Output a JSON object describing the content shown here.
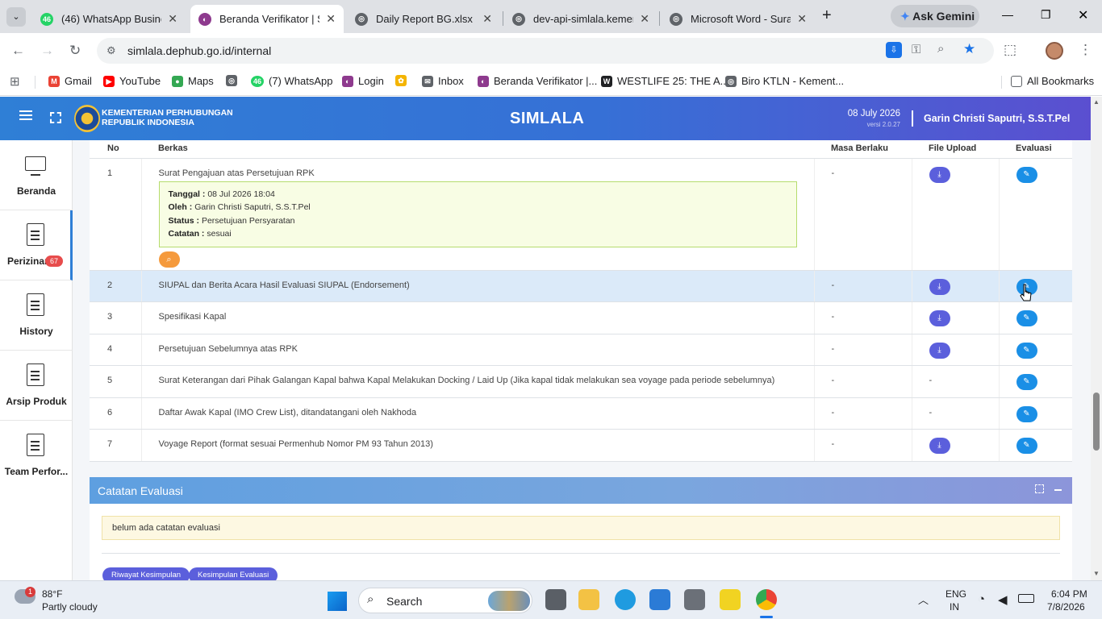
{
  "browser": {
    "tabs": [
      {
        "title": "(46) WhatsApp Busine",
        "badge": "46"
      },
      {
        "title": "Beranda Verifikator | Si"
      },
      {
        "title": "Daily Report BG.xlsx"
      },
      {
        "title": "dev-api-simlala.kemenl"
      },
      {
        "title": "Microsoft Word - Surat"
      }
    ],
    "new_tab": "+",
    "ask_gemini": "Ask Gemini",
    "url": "simlala.dephub.go.id/internal",
    "bookmarks": [
      {
        "label": "Gmail",
        "color": "#ea4335",
        "glyph": "M"
      },
      {
        "label": "YouTube",
        "color": "#ff0000",
        "glyph": "▶"
      },
      {
        "label": "Maps",
        "color": "#34a853",
        "glyph": "●"
      },
      {
        "label": "",
        "color": "#5f6368",
        "glyph": "◎"
      },
      {
        "label": "(7) WhatsApp",
        "color": "#25d366",
        "glyph": "46"
      },
      {
        "label": "Login",
        "color": "#8e3a8e",
        "glyph": "◐"
      },
      {
        "label": "",
        "color": "#f4b400",
        "glyph": "✿"
      },
      {
        "label": "Inbox",
        "color": "#5f6368",
        "glyph": "✉"
      },
      {
        "label": "Beranda Verifikator |...",
        "color": "#8e3a8e",
        "glyph": "◐"
      },
      {
        "label": "WESTLIFE 25: THE A...",
        "color": "#202124",
        "glyph": "W"
      },
      {
        "label": "Biro KTLN - Kement...",
        "color": "#5f6368",
        "glyph": "◎"
      }
    ],
    "all_bookmarks": "All Bookmarks"
  },
  "app": {
    "org_line1": "KEMENTERIAN PERHUBUNGAN",
    "org_line2": "REPUBLIK INDONESIA",
    "title": "SIMLALA",
    "date": "08 July 2026",
    "version": "versi 2.0.27",
    "user": "Garin Christi Saputri, S.S.T.Pel"
  },
  "sidebar": [
    {
      "label": "Beranda",
      "icon": "monitor-icon"
    },
    {
      "label": "Perizinan",
      "icon": "document-icon",
      "badge": "67"
    },
    {
      "label": "History",
      "icon": "document-icon"
    },
    {
      "label": "Arsip Produk",
      "icon": "document-icon"
    },
    {
      "label": "Team Perfor...",
      "icon": "document-icon"
    }
  ],
  "table": {
    "headers": [
      "No",
      "Berkas",
      "Masa Berlaku",
      "File Upload",
      "Evaluasi"
    ],
    "rows": [
      {
        "no": "1",
        "berkas": "Surat Pengajuan atas Persetujuan RPK",
        "masa": "-",
        "upload": true,
        "detail": {
          "tanggal_label": "Tanggal :",
          "tanggal": "08 Jul 2026 18:04",
          "oleh_label": "Oleh :",
          "oleh": "Garin Christi Saputri, S.S.T.Pel",
          "status_label": "Status :",
          "status": "Persetujuan Persyaratan",
          "catatan_label": "Catatan :",
          "catatan": "sesuai"
        }
      },
      {
        "no": "2",
        "berkas": "SIUPAL dan Berita Acara Hasil Evaluasi SIUPAL (Endorsement)",
        "masa": "-",
        "upload": true,
        "highlight": true
      },
      {
        "no": "3",
        "berkas": "Spesifikasi Kapal",
        "masa": "-",
        "upload": true
      },
      {
        "no": "4",
        "berkas": "Persetujuan Sebelumnya atas RPK",
        "masa": "-",
        "upload": true
      },
      {
        "no": "5",
        "berkas": "Surat Keterangan dari Pihak Galangan Kapal bahwa Kapal Melakukan Docking / Laid Up (Jika kapal tidak melakukan sea voyage pada periode sebelumnya)",
        "masa": "-",
        "upload": false,
        "upload_text": "-"
      },
      {
        "no": "6",
        "berkas": "Daftar Awak Kapal (IMO Crew List), ditandatangani oleh Nakhoda",
        "masa": "-",
        "upload": false,
        "upload_text": "-"
      },
      {
        "no": "7",
        "berkas": "Voyage Report (format sesuai Permenhub Nomor PM 93 Tahun 2013)",
        "masa": "-",
        "upload": true
      }
    ]
  },
  "panel": {
    "title": "Catatan Evaluasi",
    "note": "belum ada catatan evaluasi",
    "btn_riwayat": "Riwayat Kesimpulan",
    "btn_kesimpulan": "Kesimpulan Evaluasi"
  },
  "taskbar": {
    "temp": "88°F",
    "weather": "Partly cloudy",
    "weather_badge": "1",
    "search": "Search",
    "lang1": "ENG",
    "lang2": "IN",
    "time": "6:04 PM",
    "date": "7/8/2026"
  }
}
